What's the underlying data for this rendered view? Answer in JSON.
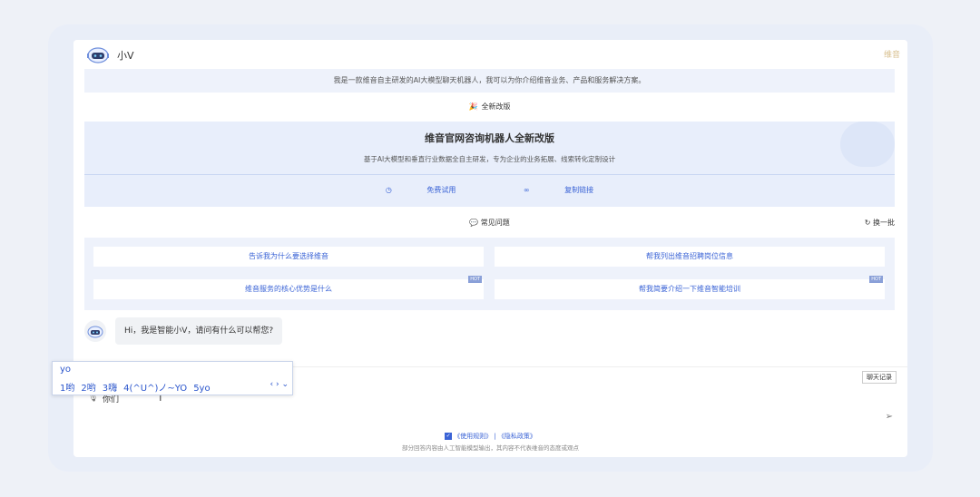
{
  "header": {
    "bot_name": "小V",
    "brand": "维音"
  },
  "intro": "我是一款维音自主研发的AI大模型聊天机器人，我可以为你介绍维音业务、产品和服务解决方案。",
  "new_version": {
    "icon": "party-icon",
    "label": "全新改版"
  },
  "card": {
    "title": "维音官网咨询机器人全新改版",
    "subtitle": "基于AI大模型和垂直行业数据全自主研发，专为企业的业务拓展、线索转化定制设计",
    "actions": {
      "trial": "免费试用",
      "copy": "复制链接"
    }
  },
  "faq": {
    "title": "常见问题",
    "refresh": "换一批"
  },
  "questions": [
    {
      "text": "告诉我为什么要选择维音",
      "hot": false
    },
    {
      "text": "帮我列出维音招聘岗位信息",
      "hot": false
    },
    {
      "text": "维音服务的核心优势是什么",
      "hot": true,
      "badge": "HOT"
    },
    {
      "text": "帮我简要介绍一下维音智能培训",
      "hot": true,
      "badge": "HOT"
    }
  ],
  "greeting": "Hi，我是智能小V，请问有什么可以帮您?",
  "toolbar": {
    "history": "聊天记录"
  },
  "input": {
    "value": "你们"
  },
  "ime": {
    "composition": "yo",
    "candidates": [
      "1哟",
      "2哟",
      "3嗨",
      "4(^U^)ノ~YO",
      "5yo"
    ],
    "nav": "‹ › ⌄"
  },
  "footer": {
    "rules": "《使用规则》",
    "separator": "|",
    "privacy": "《隐私政策》",
    "disclaimer": "部分回答内容由人工智能模型输出，其内容不代表维音的态度或观点"
  }
}
